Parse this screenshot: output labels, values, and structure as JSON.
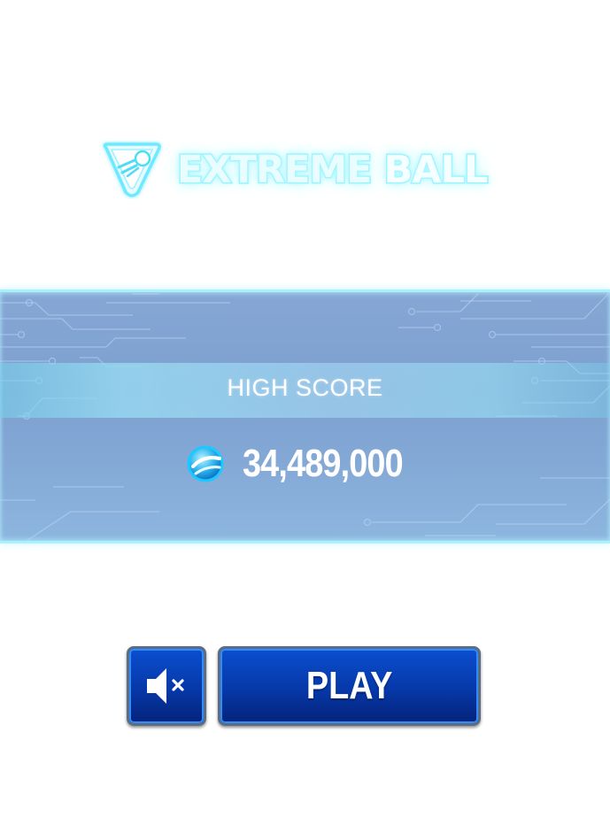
{
  "logo": {
    "word1": "EXTREME",
    "word2": "BALL",
    "emblem_icon": "ball-emblem-icon"
  },
  "score_panel": {
    "label": "HIGH SCORE",
    "value": "34,489,000",
    "coin_icon": "coin-icon"
  },
  "controls": {
    "mute_icon": "speaker-muted-icon",
    "play_label": "PLAY"
  },
  "colors": {
    "logo_glow": "#7df0ff",
    "panel_bg": "#7da0d0",
    "panel_border": "#a9f1ff",
    "button_blue": "#0638a8",
    "button_border": "#5b6c83"
  }
}
